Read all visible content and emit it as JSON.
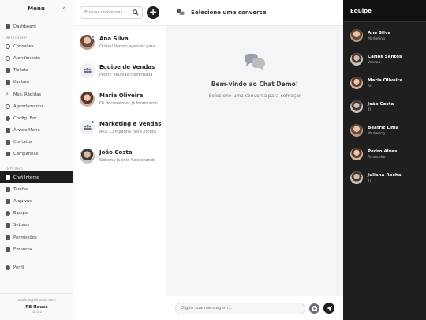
{
  "sidebar": {
    "title": "Menu",
    "items_top": [
      {
        "label": "Dashboard",
        "icon": "dashboard-icon"
      }
    ],
    "section_whatsapp": "WHATSAPP",
    "items_whatsapp": [
      {
        "label": "Conexões",
        "icon": "whatsapp-icon"
      },
      {
        "label": "Atendimento",
        "icon": "headset-icon"
      },
      {
        "label": "Tickets",
        "icon": "ticket-icon"
      },
      {
        "label": "Kanban",
        "icon": "kanban-icon"
      },
      {
        "label": "Msg. Rápidas",
        "icon": "bolt-icon"
      },
      {
        "label": "Agendamento",
        "icon": "clock-icon"
      },
      {
        "label": "Config. Bot",
        "icon": "robot-icon"
      },
      {
        "label": "Árvore Menu",
        "icon": "tree-icon"
      },
      {
        "label": "Contatos",
        "icon": "contacts-icon"
      },
      {
        "label": "Campanhas",
        "icon": "megaphone-icon"
      }
    ],
    "section_interno": "INTERNO",
    "items_interno": [
      {
        "label": "Chat Interno",
        "icon": "chat-icon",
        "active": true
      },
      {
        "label": "Tarefas",
        "icon": "tasks-icon"
      },
      {
        "label": "Arquivos",
        "icon": "folder-icon"
      },
      {
        "label": "Equipe",
        "icon": "users-icon"
      },
      {
        "label": "Setores",
        "icon": "building-icon"
      },
      {
        "label": "Permissões",
        "icon": "shield-icon"
      },
      {
        "label": "Empresa",
        "icon": "industry-icon"
      }
    ],
    "items_bottom": [
      {
        "label": "Perfil",
        "icon": "user-icon"
      }
    ],
    "footer": {
      "email": "usuário@rbhouse.com",
      "brand": "RB House",
      "version": "v2.0.0"
    }
  },
  "conversations": {
    "search_placeholder": "Buscar conversas...",
    "list": [
      {
        "name": "Ana Silva",
        "preview": "Ótimo! Vamos agendar para amanhã",
        "avatar": "photo",
        "online": true
      },
      {
        "name": "Equipe de Vendas",
        "preview": "Pedro: Reunião confirmada",
        "avatar": "group",
        "online": false
      },
      {
        "name": "Maria Oliveira",
        "preview": "Os documentos já foram enviados",
        "avatar": "photo2",
        "online": false
      },
      {
        "name": "Marketing e Vendas",
        "preview": "Ana: Campanha nova pronta",
        "avatar": "group",
        "online": true
      },
      {
        "name": "João Costa",
        "preview": "Sistema já está funcionando",
        "avatar": "photo3",
        "online": false
      }
    ]
  },
  "main": {
    "header_title": "Selecione uma conversa",
    "welcome_title": "Bem-vindo ao Chat Demo!",
    "welcome_subtitle": "Selecione uma conversa para começar",
    "composer_placeholder": "Digite sua mensagem..."
  },
  "team": {
    "title": "Equipe",
    "members": [
      {
        "name": "Ana Silva",
        "role": "Marketing"
      },
      {
        "name": "Carlos Santos",
        "role": "Vendas"
      },
      {
        "name": "Maria Oliveira",
        "role": "RH"
      },
      {
        "name": "João Costa",
        "role": "TI"
      },
      {
        "name": "Beatriz Lima",
        "role": "Marketing"
      },
      {
        "name": "Pedro Alves",
        "role": "Financeiro"
      },
      {
        "name": "Juliana Rocha",
        "role": "TI"
      }
    ]
  },
  "colors": {
    "accent": "#1f1f1f",
    "online": "#4c8bf5",
    "team_bg": "#1f1f1f"
  }
}
